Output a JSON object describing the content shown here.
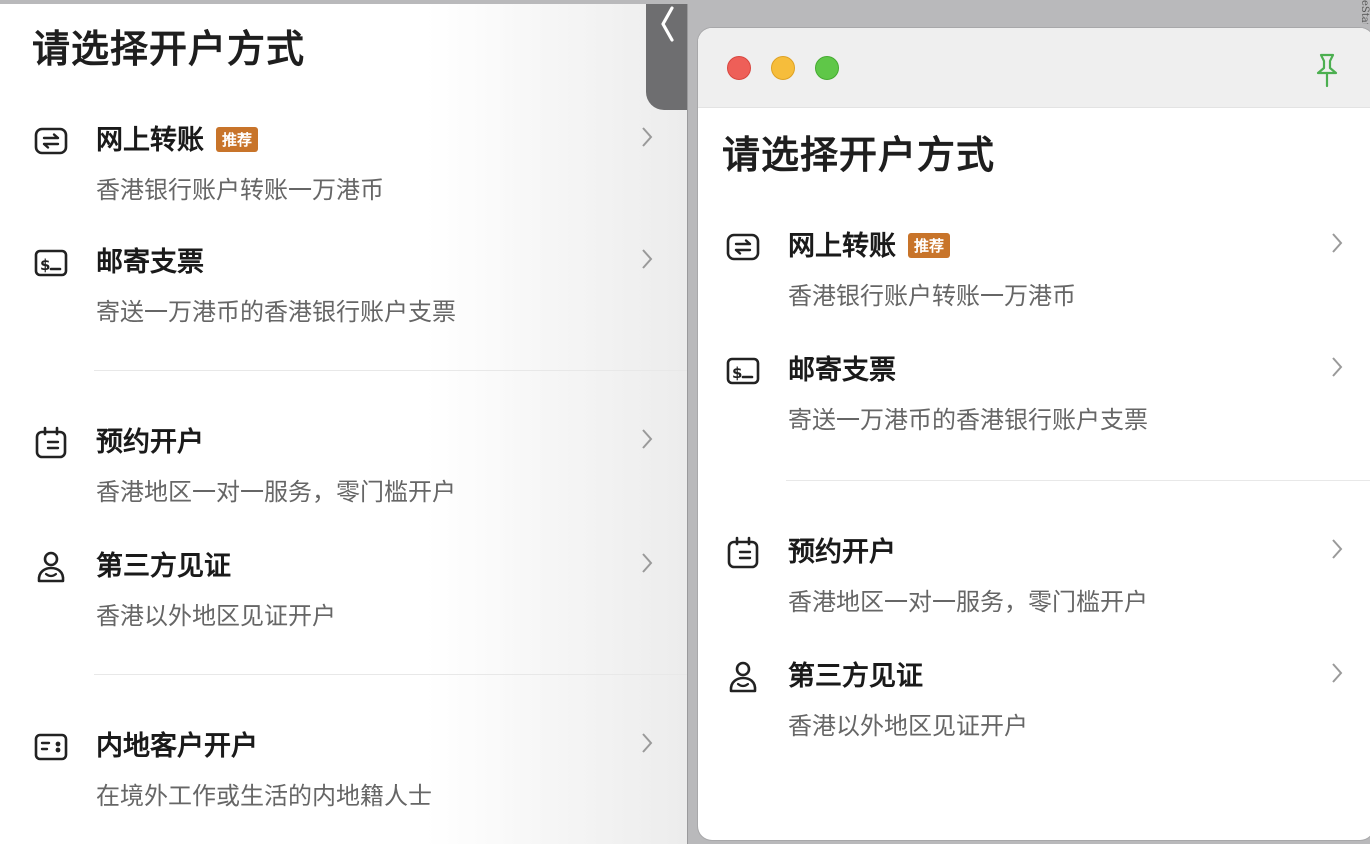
{
  "left": {
    "title": "请选择开户方式",
    "groups": [
      [
        {
          "icon": "transfer-icon",
          "name": "网上转账",
          "badge": "推荐",
          "desc": "香港银行账户转账一万港币"
        },
        {
          "icon": "check-icon",
          "name": "邮寄支票",
          "badge": "",
          "desc": "寄送一万港币的香港银行账户支票"
        }
      ],
      [
        {
          "icon": "calendar-icon",
          "name": "预约开户",
          "badge": "",
          "desc": "香港地区一对一服务，零门槛开户"
        },
        {
          "icon": "person-icon",
          "name": "第三方见证",
          "badge": "",
          "desc": "香港以外地区见证开户"
        }
      ],
      [
        {
          "icon": "id-card-icon",
          "name": "内地客户开户",
          "badge": "",
          "desc": "在境外工作或生活的内地籍人士"
        }
      ]
    ]
  },
  "right": {
    "title": "请选择开户方式",
    "groups": [
      [
        {
          "icon": "transfer-icon",
          "name": "网上转账",
          "badge": "推荐",
          "desc": "香港银行账户转账一万港币"
        },
        {
          "icon": "check-icon",
          "name": "邮寄支票",
          "badge": "",
          "desc": "寄送一万港币的香港银行账户支票"
        }
      ],
      [
        {
          "icon": "calendar-icon",
          "name": "预约开户",
          "badge": "",
          "desc": "香港地区一对一服务，零门槛开户"
        },
        {
          "icon": "person-icon",
          "name": "第三方见证",
          "badge": "",
          "desc": "香港以外地区见证开户"
        }
      ]
    ]
  },
  "edge_text": "eStat",
  "colors": {
    "badge": "#c8742a",
    "pin": "#4caf50",
    "traffic_red": "#ee5f58",
    "traffic_yellow": "#f6bd3b",
    "traffic_green": "#5fc748"
  }
}
